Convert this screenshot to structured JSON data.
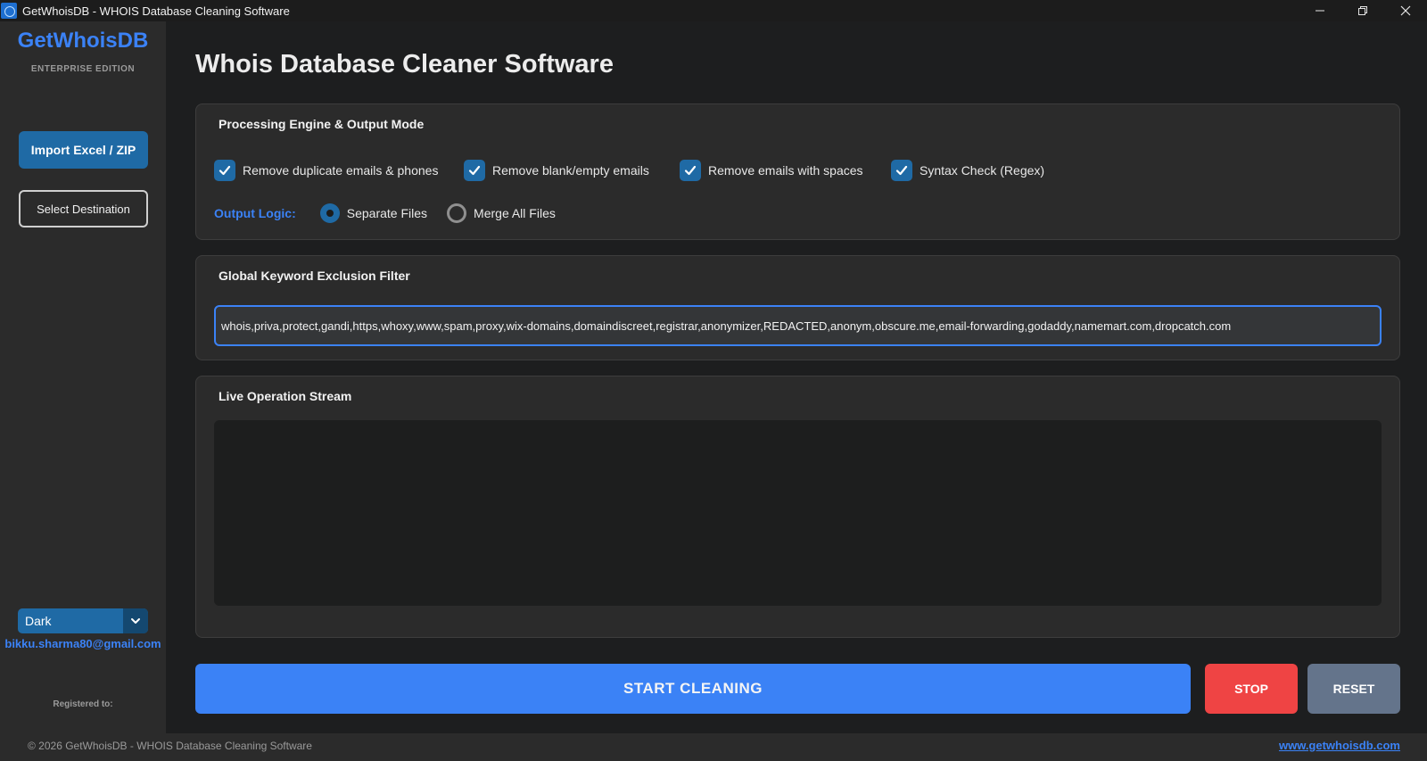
{
  "window": {
    "title": "GetWhoisDB - WHOIS Database Cleaning Software"
  },
  "sidebar": {
    "brand": "GetWhoisDB",
    "edition": "ENTERPRISE EDITION",
    "import_label": "Import Excel / ZIP",
    "destination_label": "Select Destination",
    "theme": {
      "selected": "Dark"
    },
    "user_email": "bikku.sharma80@gmail.com",
    "registered_label": "Registered to:"
  },
  "main": {
    "title": "Whois Database Cleaner Software",
    "engine_panel": {
      "title": "Processing Engine & Output Mode",
      "checkboxes": [
        {
          "label": "Remove duplicate emails & phones",
          "checked": true
        },
        {
          "label": "Remove blank/empty emails",
          "checked": true
        },
        {
          "label": "Remove emails with spaces",
          "checked": true
        },
        {
          "label": "Syntax Check (Regex)",
          "checked": true
        }
      ],
      "output_logic_label": "Output Logic:",
      "output_options": [
        {
          "label": "Separate Files",
          "selected": true
        },
        {
          "label": "Merge All Files",
          "selected": false
        }
      ]
    },
    "filter_panel": {
      "title": "Global Keyword Exclusion Filter",
      "keywords": "whois,priva,protect,gandi,https,whoxy,www,spam,proxy,wix-domains,domaindiscreet,registrar,anonymizer,REDACTED,anonym,obscure.me,email-forwarding,godaddy,namemart.com,dropcatch.com"
    },
    "log_panel": {
      "title": "Live Operation Stream"
    },
    "actions": {
      "start_label": "START CLEANING",
      "stop_label": "STOP",
      "reset_label": "RESET"
    }
  },
  "footer": {
    "copyright": "© 2026 GetWhoisDB - WHOIS Database Cleaning Software",
    "website": "www.getwhoisdb.com"
  },
  "colors": {
    "accent": "#3b82f6",
    "primary_button": "#1f6aa5",
    "stop": "#ef4444",
    "reset": "#64748b",
    "background": "#1d1e1f",
    "panel": "#2b2b2b"
  },
  "icons": {
    "app": "app-logo-icon",
    "minimize": "minimize-icon",
    "restore": "restore-icon",
    "close": "close-icon",
    "check": "checkmark-icon",
    "dropdown": "chevron-down-icon"
  }
}
